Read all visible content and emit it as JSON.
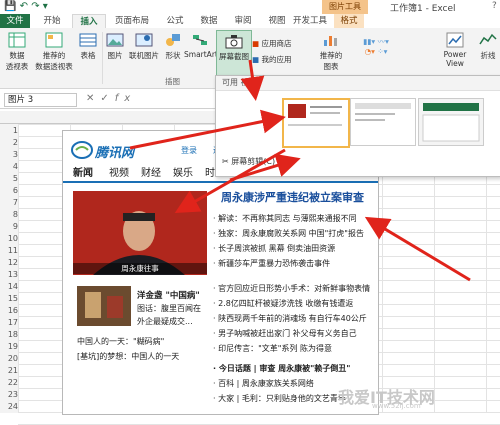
{
  "titlebar": {
    "context_tab": "图片工具",
    "title": "工作簿1 - Excel",
    "help": "?"
  },
  "tabs": [
    "文件",
    "开始",
    "插入",
    "页面布局",
    "公式",
    "数据",
    "审阅",
    "视图",
    "开发工具",
    "格式"
  ],
  "ribbon": {
    "pivot_label": "数据\n透视表",
    "recommended_pivot": "推荐的\n数据透视表",
    "table_label": "表格",
    "pictures": "图片",
    "online_pictures": "联机图片",
    "shapes": "形状",
    "smartart": "SmartArt",
    "screenshot": "屏幕截图",
    "app_store": "应用商店",
    "my_apps": "我的应用",
    "recommended_charts": "推荐的\n图表",
    "power_view": "Power\nView",
    "group_illustrations": "插图",
    "group_right": "折线"
  },
  "formula_bar": {
    "name_box": "图片 3",
    "fx": "fx"
  },
  "row_numbers": [
    "1",
    "2",
    "3",
    "4",
    "5",
    "6",
    "7",
    "8",
    "9",
    "10",
    "11",
    "12",
    "13",
    "14",
    "15",
    "16",
    "17",
    "18",
    "19",
    "20",
    "21",
    "22",
    "23",
    "24"
  ],
  "screenshot_panel": {
    "header": "可用 视窗",
    "clipping": "屏幕剪辑(C)"
  },
  "web": {
    "logo": "腾讯网",
    "links": [
      "登录",
      "进入",
      "我的"
    ],
    "nav": [
      "新闻",
      "视频",
      "财经",
      "娱乐",
      "时尚"
    ],
    "headline": "周永康涉严重违纪被立案审查",
    "caption": "周永康往事",
    "news": [
      "· 解读：不再称其同志 与薄熙来通报不同",
      "· 独家：周永康腐败关系网 中国\"打虎\"报告",
      "· 长子周滨被抓 黑幕 倒卖油田资源",
      "· 新疆莎车严重暴力恐怖袭击事件",
      "· 官方回应近日形势小手术：对新鲜事物表情",
      "· 2.8亿四缸杆被疑涉洗钱 收缴有钱遭返",
      "· 陕西现两千年前的消魂场 有自行车40公斤",
      "· 男子呐喊被赶出家门 补父母有义务自己",
      "· 印尼传言：\"文革\"系列 陈为得意",
      "· 今日话题 | 审查 周永康被\"赖子倒丑\"",
      "· 百科 | 周永康家族关系网络",
      "· 大家 | 毛利：只利贴身他的文艺青年"
    ],
    "feature_title": "洋金盏 \"中国病\"",
    "feature_text": [
      "图话：腹里百闻在",
      "外企最疑成交..."
    ],
    "bottom_links": [
      "中国人的一天：\"糊码病\"",
      "[基坑]的梦想：中国人的一天"
    ],
    "watermark": "我爱IT技术网",
    "watermark_url": "www.52ij.com"
  },
  "colors": {
    "excel_green": "#217346",
    "arrow_red": "#e0241b",
    "qq_blue": "#1a6fb5"
  }
}
